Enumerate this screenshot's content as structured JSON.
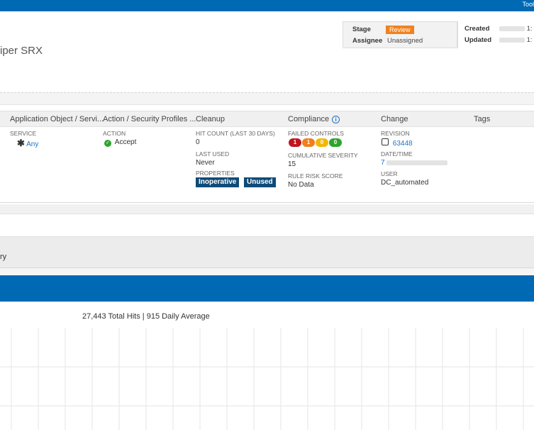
{
  "topbar": {
    "tools": "Tool"
  },
  "title": "iper SRX",
  "meta": {
    "stage_label": "Stage",
    "stage_value": "Review",
    "assignee_label": "Assignee",
    "assignee_value": "Unassigned",
    "created_label": "Created",
    "created_value": "1:",
    "updated_label": "Updated",
    "updated_value": "1:"
  },
  "table": {
    "headers": [
      "Application Object / Servi...",
      "Action / Security Profiles ...",
      "Cleanup",
      "Compliance",
      "Change",
      "Tags"
    ],
    "service_label": "SERVICE",
    "service_value": "Any",
    "action_label": "ACTION",
    "action_value": "Accept",
    "hit_count_label": "HIT COUNT (LAST 30 DAYS)",
    "hit_count_value": "0",
    "last_used_label": "LAST USED",
    "last_used_value": "Never",
    "properties_label": "PROPERTIES",
    "prop_inoperative": "Inoperative",
    "prop_unused": "Unused",
    "failed_controls_label": "FAILED CONTROLS",
    "controls": [
      {
        "value": "1",
        "color": "#c0161f"
      },
      {
        "value": "1",
        "color": "#f07d1e"
      },
      {
        "value": "0",
        "color": "#f2b705"
      },
      {
        "value": "0",
        "color": "#2da52d"
      }
    ],
    "cumulative_label": "CUMULATIVE SEVERITY",
    "cumulative_value": "15",
    "risk_label": "RULE RISK SCORE",
    "risk_value": "No Data",
    "revision_label": "REVISION",
    "revision_value": "63448",
    "datetime_label": "DATE/TIME",
    "datetime_value": "7",
    "user_label": "USER",
    "user_value": "DC_automated"
  },
  "history_fragment": "ry",
  "chart": {
    "summary": "27,443 Total Hits | 915 Daily Average"
  },
  "colors": {
    "brand_blue": "#0069b4",
    "badge_dark": "#0f4b78",
    "review_orange": "#f0821e",
    "link": "#1a73c7"
  }
}
